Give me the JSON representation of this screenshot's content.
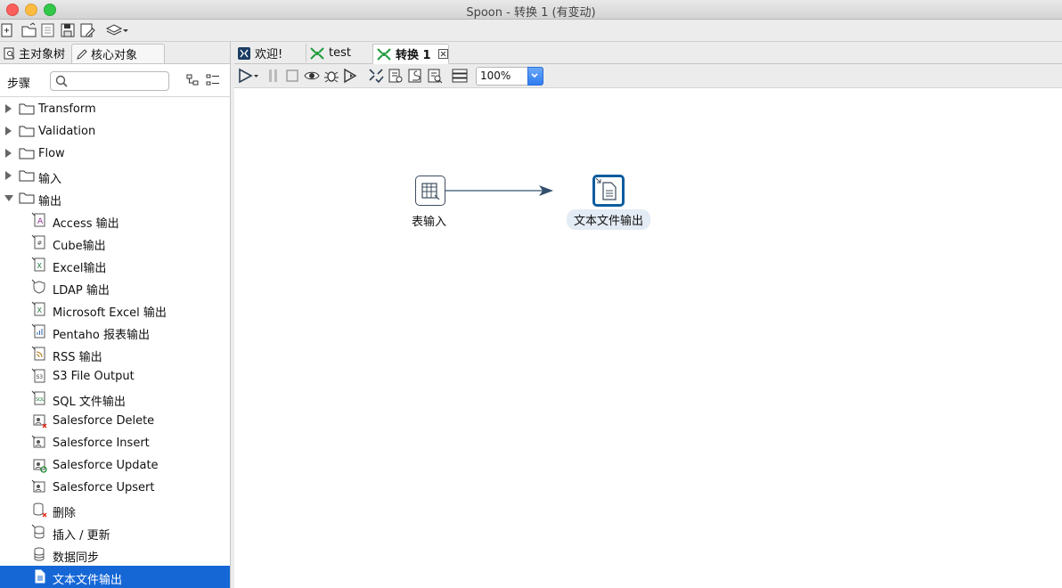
{
  "window": {
    "title": "Spoon - 转换 1 (有变动)"
  },
  "left_tabs": [
    {
      "label": "主对象树",
      "icon": "object-tree-icon"
    },
    {
      "label": "核心对象",
      "icon": "pencil-icon"
    }
  ],
  "steps_panel": {
    "label": "步骤",
    "search_placeholder": ""
  },
  "tree": {
    "folders": [
      {
        "label": "Transform",
        "expanded": false
      },
      {
        "label": "Validation",
        "expanded": false
      },
      {
        "label": "Flow",
        "expanded": false
      },
      {
        "label": "输入",
        "expanded": false
      },
      {
        "label": "输出",
        "expanded": true
      }
    ],
    "output_steps": [
      {
        "label": "Access 输出",
        "icon": "access-output-icon"
      },
      {
        "label": "Cube输出",
        "icon": "cube-output-icon"
      },
      {
        "label": "Excel输出",
        "icon": "excel-output-icon"
      },
      {
        "label": "LDAP 输出",
        "icon": "ldap-output-icon"
      },
      {
        "label": "Microsoft Excel 输出",
        "icon": "microsoft-excel-output-icon"
      },
      {
        "label": "Pentaho 报表输出",
        "icon": "pentaho-report-output-icon"
      },
      {
        "label": "RSS 输出",
        "icon": "rss-output-icon"
      },
      {
        "label": "S3 File Output",
        "icon": "s3-file-output-icon"
      },
      {
        "label": "SQL 文件输出",
        "icon": "sql-file-output-icon"
      },
      {
        "label": "Salesforce Delete",
        "icon": "salesforce-delete-icon"
      },
      {
        "label": "Salesforce Insert",
        "icon": "salesforce-insert-icon"
      },
      {
        "label": "Salesforce Update",
        "icon": "salesforce-update-icon"
      },
      {
        "label": "Salesforce Upsert",
        "icon": "salesforce-upsert-icon"
      },
      {
        "label": "删除",
        "icon": "delete-icon"
      },
      {
        "label": "插入 / 更新",
        "icon": "insert-update-icon"
      },
      {
        "label": "数据同步",
        "icon": "data-sync-icon"
      },
      {
        "label": "文本文件输出",
        "icon": "text-file-output-icon",
        "selected": true
      }
    ]
  },
  "right_tabs": [
    {
      "label": "欢迎!",
      "icon": "welcome-icon"
    },
    {
      "label": "test",
      "icon": "transformation-icon"
    },
    {
      "label": "转换 1",
      "icon": "transformation-icon",
      "active": true,
      "closable": true
    }
  ],
  "canvas_toolbar": {
    "zoom": "100%"
  },
  "canvas": {
    "steps": [
      {
        "label": "表输入",
        "icon": "table-input-icon"
      },
      {
        "label": "文本文件输出",
        "icon": "text-file-output-icon",
        "selected": true
      }
    ],
    "hops": [
      {
        "from": "表输入",
        "to": "文本文件输出"
      }
    ]
  },
  "colors": {
    "selection": "#1667d6",
    "hop": "#34506e",
    "node_selected_border": "#0e5c9e"
  }
}
